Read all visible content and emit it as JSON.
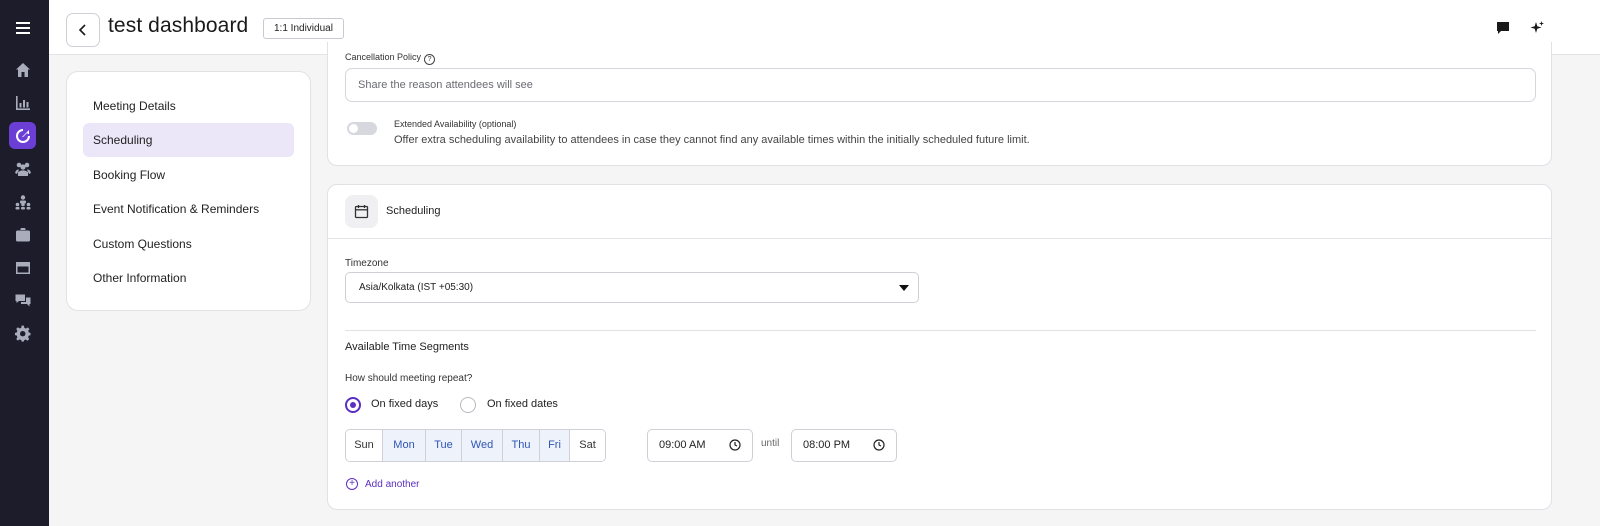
{
  "header": {
    "title": "test dashboard",
    "badge": "1:1 Individual"
  },
  "rail": {
    "icons": [
      "menu-icon",
      "home-icon",
      "analytics-icon",
      "scheduling-icon",
      "people-icon",
      "team-icon",
      "briefcase-icon",
      "calendar-window-icon",
      "chat-icon",
      "settings-icon"
    ],
    "active": "scheduling-icon",
    "active_color": "#6b3fd6"
  },
  "nav": {
    "items": [
      {
        "label": "Meeting Details"
      },
      {
        "label": "Scheduling"
      },
      {
        "label": "Booking Flow"
      },
      {
        "label": "Event Notification & Reminders"
      },
      {
        "label": "Custom Questions"
      },
      {
        "label": "Other Information"
      }
    ],
    "active": "Scheduling"
  },
  "cancellation": {
    "label": "Cancellation Policy",
    "placeholder": "Share the reason attendees will see",
    "extended_title": "Extended Availability (optional)",
    "extended_desc": "Offer extra scheduling availability to attendees in case they cannot find any available times within the initially scheduled future limit.",
    "extended_enabled": false
  },
  "scheduling": {
    "section_title": "Scheduling",
    "timezone_label": "Timezone",
    "timezone_value": "Asia/Kolkata (IST +05:30)",
    "segments_title": "Available Time Segments",
    "repeat_question": "How should meeting repeat?",
    "repeat_options": [
      {
        "label": "On fixed days",
        "checked": true
      },
      {
        "label": "On fixed dates",
        "checked": false
      }
    ],
    "days": [
      {
        "label": "Sun",
        "selected": false
      },
      {
        "label": "Mon",
        "selected": true
      },
      {
        "label": "Tue",
        "selected": true
      },
      {
        "label": "Wed",
        "selected": true
      },
      {
        "label": "Thu",
        "selected": true
      },
      {
        "label": "Fri",
        "selected": true
      },
      {
        "label": "Sat",
        "selected": false
      }
    ],
    "start_time": "09:00 AM",
    "until_label": "until",
    "end_time": "08:00 PM",
    "add_another": "Add another",
    "accent_color": "#5a2fc2",
    "selected_day_color": "#2f56b5"
  }
}
